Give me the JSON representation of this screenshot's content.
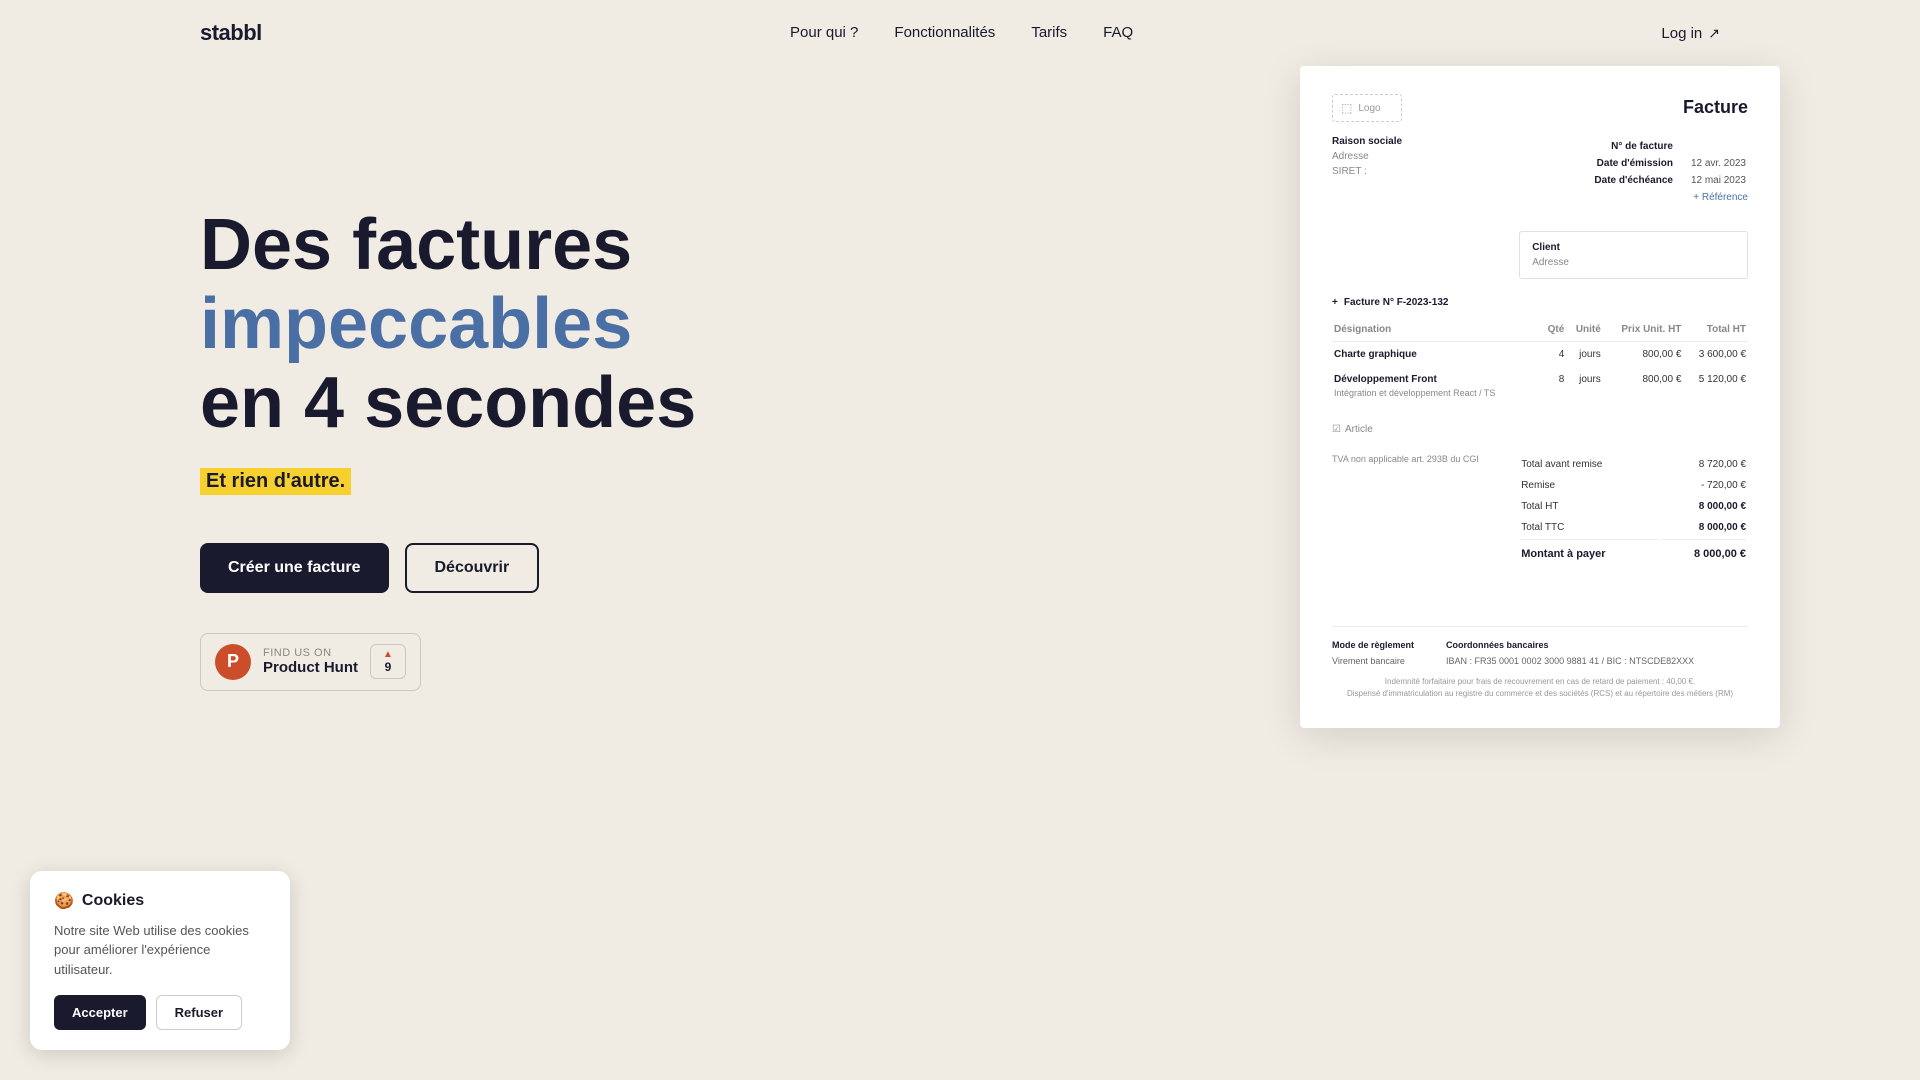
{
  "brand": {
    "name": "stabbl"
  },
  "navbar": {
    "links": [
      {
        "label": "Pour qui ?",
        "href": "#"
      },
      {
        "label": "Fonctionnalités",
        "href": "#"
      },
      {
        "label": "Tarifs",
        "href": "#"
      },
      {
        "label": "FAQ",
        "href": "#"
      }
    ],
    "login_label": "Log in"
  },
  "hero": {
    "title_line1": "Des factures",
    "title_line2": "impeccables",
    "title_line3": "en 4 secondes",
    "subtitle": "Et rien d'autre.",
    "btn_create": "Créer une facture",
    "btn_discover": "Découvrir"
  },
  "product_hunt": {
    "find_us_label": "FIND US ON",
    "name": "Product Hunt",
    "votes": "9",
    "logo_letter": "P"
  },
  "invoice": {
    "logo_label": "Logo",
    "facture_title": "Facture",
    "company_name": "Raison sociale",
    "company_address": "Adresse",
    "company_siret": "SIRET :",
    "meta_numero_label": "N° de facture",
    "meta_emission_label": "Date d'émission",
    "meta_echeance_label": "Date d'échéance",
    "meta_emission_value": "12 avr. 2023",
    "meta_echeance_value": "12 mai 2023",
    "meta_reference_label": "+ Référence",
    "client_label": "Client",
    "client_address": "Adresse",
    "section_label": "Facture N° F-2023-132",
    "table_headers": [
      "Désignation",
      "Qté",
      "Unité",
      "Prix Unit. HT",
      "Total HT"
    ],
    "table_rows": [
      {
        "name": "Charte graphique",
        "desc": "",
        "qty": "4",
        "unit": "jours",
        "price": "800,00 €",
        "total": "3 600,00 €"
      },
      {
        "name": "Développement Front",
        "desc": "Intégration et développement React / TS",
        "qty": "8",
        "unit": "jours",
        "price": "800,00 €",
        "total": "5 120,00 €"
      }
    ],
    "add_article_label": "Article",
    "tva_note": "TVA non applicable art. 293B du CGI",
    "totals": {
      "avant_remise_label": "Total avant remise",
      "avant_remise_value": "8 720,00 €",
      "remise_label": "Remise",
      "remise_value": "- 720,00 €",
      "ht_label": "Total HT",
      "ht_value": "8 000,00 €",
      "ttc_label": "Total TTC",
      "ttc_value": "8 000,00 €",
      "montant_label": "Montant à payer",
      "montant_value": "8 000,00 €"
    },
    "payment_mode_label": "Mode de règlement",
    "payment_mode_value": "Virement bancaire",
    "bank_label": "Coordonnées bancaires",
    "bank_value": "IBAN : FR35 0001 0002 3000 9881 41 / BIC : NTSCDE82XXX",
    "legal_line1": "Indemnité forfaitaire pour frais de recouvrement en cas de retard de paiement : 40,00 €.",
    "legal_line2": "Dispensé d'immatriculation au registre du commerce et des sociétés (RCS) et au répertoire des métiers (RM)"
  },
  "cookies": {
    "title": "Cookies",
    "emoji": "🍪",
    "text": "Notre site Web utilise des cookies pour améliorer l'expérience utilisateur.",
    "accept_label": "Accepter",
    "refuse_label": "Refuser"
  }
}
